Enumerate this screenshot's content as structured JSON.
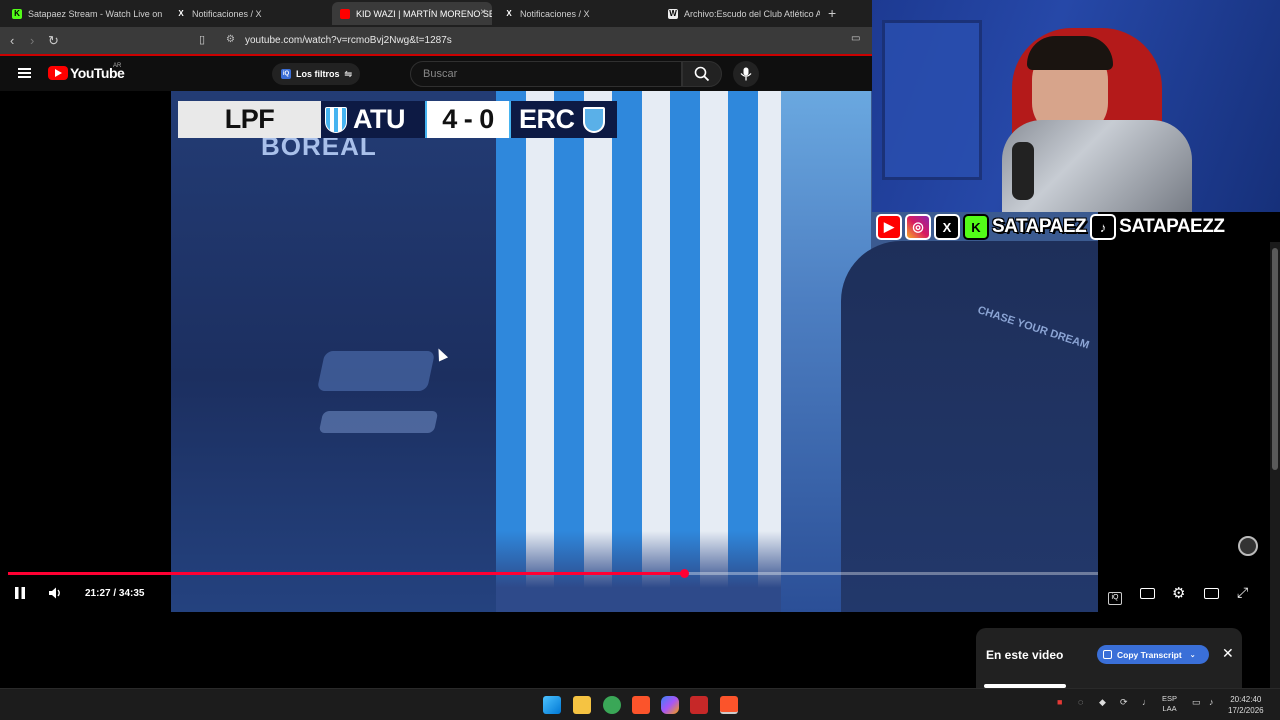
{
  "browser": {
    "tabs": [
      {
        "label": "Satapaez Stream - Watch Live on Kick",
        "favicon": "kick-icon",
        "active": false
      },
      {
        "label": "Notificaciones / X",
        "favicon": "x-icon",
        "active": false
      },
      {
        "label": "KID WAZI | MARTÍN MORENO SE",
        "favicon": "youtube-icon",
        "active": true
      },
      {
        "label": "Notificaciones / X",
        "favicon": "x-icon",
        "active": false
      },
      {
        "label": "Archivo:Escudo del Club Atlético All B",
        "favicon": "wikipedia-icon",
        "active": false
      }
    ],
    "new_tab": "+",
    "close": "×",
    "url": "youtube.com/watch?v=rcmoBvj2Nwg&t=1287s"
  },
  "youtube": {
    "logo_text": "YouTube",
    "country": "AR",
    "filters_label": "Los filtros",
    "search_placeholder": "Buscar"
  },
  "video": {
    "scoreboard": {
      "league": "LPF",
      "home": "ATU",
      "score": "4 - 0",
      "away": "ERC"
    },
    "time_current_total": "21:27 / 34:35",
    "progress": 0.62
  },
  "overlay": {
    "kick_letter": "K",
    "handle_1": "SATAPAEZ",
    "handle_2": "SATAPAEZZ"
  },
  "panel": {
    "title": "En este video",
    "copy_button": "Copy Transcript",
    "close": "✕"
  },
  "taskbar": {
    "lang_top": "ESP",
    "lang_bottom": "LAA",
    "time": "20:42:40",
    "date": "17/2/2026"
  },
  "colors": {
    "accent_red": "#ff0033",
    "atlético_blue": "#46b4f0",
    "navy": "#0d1a44"
  }
}
